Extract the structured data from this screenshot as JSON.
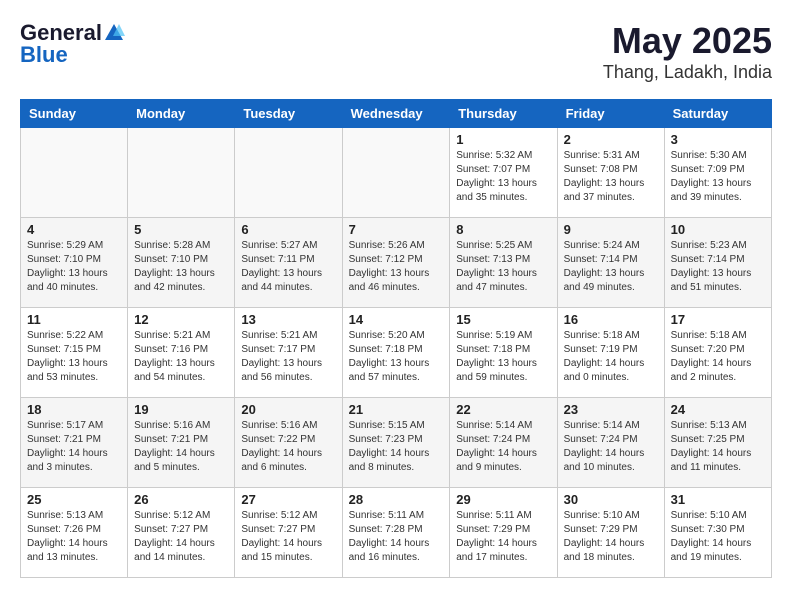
{
  "logo": {
    "general": "General",
    "blue": "Blue"
  },
  "header": {
    "month": "May 2025",
    "location": "Thang, Ladakh, India"
  },
  "weekdays": [
    "Sunday",
    "Monday",
    "Tuesday",
    "Wednesday",
    "Thursday",
    "Friday",
    "Saturday"
  ],
  "rows": [
    {
      "cells": [
        {
          "day": "",
          "sunrise": "",
          "sunset": "",
          "daylight": ""
        },
        {
          "day": "",
          "sunrise": "",
          "sunset": "",
          "daylight": ""
        },
        {
          "day": "",
          "sunrise": "",
          "sunset": "",
          "daylight": ""
        },
        {
          "day": "",
          "sunrise": "",
          "sunset": "",
          "daylight": ""
        },
        {
          "day": "1",
          "sunrise": "Sunrise: 5:32 AM",
          "sunset": "Sunset: 7:07 PM",
          "daylight": "Daylight: 13 hours and 35 minutes."
        },
        {
          "day": "2",
          "sunrise": "Sunrise: 5:31 AM",
          "sunset": "Sunset: 7:08 PM",
          "daylight": "Daylight: 13 hours and 37 minutes."
        },
        {
          "day": "3",
          "sunrise": "Sunrise: 5:30 AM",
          "sunset": "Sunset: 7:09 PM",
          "daylight": "Daylight: 13 hours and 39 minutes."
        }
      ]
    },
    {
      "cells": [
        {
          "day": "4",
          "sunrise": "Sunrise: 5:29 AM",
          "sunset": "Sunset: 7:10 PM",
          "daylight": "Daylight: 13 hours and 40 minutes."
        },
        {
          "day": "5",
          "sunrise": "Sunrise: 5:28 AM",
          "sunset": "Sunset: 7:10 PM",
          "daylight": "Daylight: 13 hours and 42 minutes."
        },
        {
          "day": "6",
          "sunrise": "Sunrise: 5:27 AM",
          "sunset": "Sunset: 7:11 PM",
          "daylight": "Daylight: 13 hours and 44 minutes."
        },
        {
          "day": "7",
          "sunrise": "Sunrise: 5:26 AM",
          "sunset": "Sunset: 7:12 PM",
          "daylight": "Daylight: 13 hours and 46 minutes."
        },
        {
          "day": "8",
          "sunrise": "Sunrise: 5:25 AM",
          "sunset": "Sunset: 7:13 PM",
          "daylight": "Daylight: 13 hours and 47 minutes."
        },
        {
          "day": "9",
          "sunrise": "Sunrise: 5:24 AM",
          "sunset": "Sunset: 7:14 PM",
          "daylight": "Daylight: 13 hours and 49 minutes."
        },
        {
          "day": "10",
          "sunrise": "Sunrise: 5:23 AM",
          "sunset": "Sunset: 7:14 PM",
          "daylight": "Daylight: 13 hours and 51 minutes."
        }
      ]
    },
    {
      "cells": [
        {
          "day": "11",
          "sunrise": "Sunrise: 5:22 AM",
          "sunset": "Sunset: 7:15 PM",
          "daylight": "Daylight: 13 hours and 53 minutes."
        },
        {
          "day": "12",
          "sunrise": "Sunrise: 5:21 AM",
          "sunset": "Sunset: 7:16 PM",
          "daylight": "Daylight: 13 hours and 54 minutes."
        },
        {
          "day": "13",
          "sunrise": "Sunrise: 5:21 AM",
          "sunset": "Sunset: 7:17 PM",
          "daylight": "Daylight: 13 hours and 56 minutes."
        },
        {
          "day": "14",
          "sunrise": "Sunrise: 5:20 AM",
          "sunset": "Sunset: 7:18 PM",
          "daylight": "Daylight: 13 hours and 57 minutes."
        },
        {
          "day": "15",
          "sunrise": "Sunrise: 5:19 AM",
          "sunset": "Sunset: 7:18 PM",
          "daylight": "Daylight: 13 hours and 59 minutes."
        },
        {
          "day": "16",
          "sunrise": "Sunrise: 5:18 AM",
          "sunset": "Sunset: 7:19 PM",
          "daylight": "Daylight: 14 hours and 0 minutes."
        },
        {
          "day": "17",
          "sunrise": "Sunrise: 5:18 AM",
          "sunset": "Sunset: 7:20 PM",
          "daylight": "Daylight: 14 hours and 2 minutes."
        }
      ]
    },
    {
      "cells": [
        {
          "day": "18",
          "sunrise": "Sunrise: 5:17 AM",
          "sunset": "Sunset: 7:21 PM",
          "daylight": "Daylight: 14 hours and 3 minutes."
        },
        {
          "day": "19",
          "sunrise": "Sunrise: 5:16 AM",
          "sunset": "Sunset: 7:21 PM",
          "daylight": "Daylight: 14 hours and 5 minutes."
        },
        {
          "day": "20",
          "sunrise": "Sunrise: 5:16 AM",
          "sunset": "Sunset: 7:22 PM",
          "daylight": "Daylight: 14 hours and 6 minutes."
        },
        {
          "day": "21",
          "sunrise": "Sunrise: 5:15 AM",
          "sunset": "Sunset: 7:23 PM",
          "daylight": "Daylight: 14 hours and 8 minutes."
        },
        {
          "day": "22",
          "sunrise": "Sunrise: 5:14 AM",
          "sunset": "Sunset: 7:24 PM",
          "daylight": "Daylight: 14 hours and 9 minutes."
        },
        {
          "day": "23",
          "sunrise": "Sunrise: 5:14 AM",
          "sunset": "Sunset: 7:24 PM",
          "daylight": "Daylight: 14 hours and 10 minutes."
        },
        {
          "day": "24",
          "sunrise": "Sunrise: 5:13 AM",
          "sunset": "Sunset: 7:25 PM",
          "daylight": "Daylight: 14 hours and 11 minutes."
        }
      ]
    },
    {
      "cells": [
        {
          "day": "25",
          "sunrise": "Sunrise: 5:13 AM",
          "sunset": "Sunset: 7:26 PM",
          "daylight": "Daylight: 14 hours and 13 minutes."
        },
        {
          "day": "26",
          "sunrise": "Sunrise: 5:12 AM",
          "sunset": "Sunset: 7:27 PM",
          "daylight": "Daylight: 14 hours and 14 minutes."
        },
        {
          "day": "27",
          "sunrise": "Sunrise: 5:12 AM",
          "sunset": "Sunset: 7:27 PM",
          "daylight": "Daylight: 14 hours and 15 minutes."
        },
        {
          "day": "28",
          "sunrise": "Sunrise: 5:11 AM",
          "sunset": "Sunset: 7:28 PM",
          "daylight": "Daylight: 14 hours and 16 minutes."
        },
        {
          "day": "29",
          "sunrise": "Sunrise: 5:11 AM",
          "sunset": "Sunset: 7:29 PM",
          "daylight": "Daylight: 14 hours and 17 minutes."
        },
        {
          "day": "30",
          "sunrise": "Sunrise: 5:10 AM",
          "sunset": "Sunset: 7:29 PM",
          "daylight": "Daylight: 14 hours and 18 minutes."
        },
        {
          "day": "31",
          "sunrise": "Sunrise: 5:10 AM",
          "sunset": "Sunset: 7:30 PM",
          "daylight": "Daylight: 14 hours and 19 minutes."
        }
      ]
    }
  ]
}
